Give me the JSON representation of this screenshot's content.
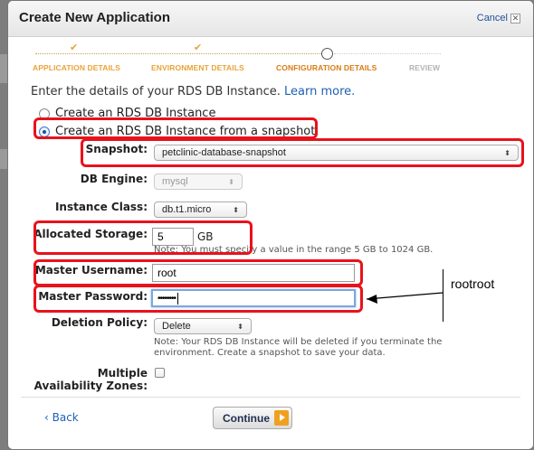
{
  "dialog": {
    "title": "Create New Application",
    "cancel_label": "Cancel",
    "cancel_icon": "close-icon"
  },
  "steps": [
    {
      "label": "APPLICATION DETAILS",
      "state": "done"
    },
    {
      "label": "ENVIRONMENT DETAILS",
      "state": "done"
    },
    {
      "label": "CONFIGURATION DETAILS",
      "state": "current"
    },
    {
      "label": "REVIEW",
      "state": "pending"
    }
  ],
  "step_check_glyph": "✔",
  "intro": {
    "text": "Enter the details of your RDS DB Instance.",
    "link": "Learn more."
  },
  "source": {
    "options": [
      {
        "label": "Create an RDS DB Instance",
        "selected": false
      },
      {
        "label": "Create an RDS DB Instance from a snapshot",
        "selected": true
      }
    ]
  },
  "fields": {
    "snapshot": {
      "label": "Snapshot:",
      "value": "petclinic-database-snapshot"
    },
    "engine": {
      "label": "DB Engine:",
      "value": "mysql",
      "disabled": true
    },
    "instance_class": {
      "label": "Instance Class:",
      "value": "db.t1.micro"
    },
    "storage": {
      "label": "Allocated Storage:",
      "value": "5",
      "unit": "GB",
      "note": "Note: You must specify a value in the range 5 GB to 1024 GB."
    },
    "username": {
      "label": "Master Username:",
      "value": "root"
    },
    "password": {
      "label": "Master Password:",
      "value": "••••••••"
    },
    "deletion_policy": {
      "label": "Deletion Policy:",
      "value": "Delete",
      "note_line1": "Note: Your RDS DB Instance will be deleted if you terminate the",
      "note_line2": "environment. Create a snapshot to save your data."
    },
    "multi_az": {
      "label_line1": "Multiple",
      "label_line2": "Availability Zones:",
      "checked": false
    }
  },
  "footer": {
    "back_label": "‹ Back",
    "continue_label": "Continue"
  },
  "annotation": {
    "callout_text": "rootroot",
    "highlight_color": "#e8121b"
  },
  "colors": {
    "accent_orange": "#e8a33d",
    "link_blue": "#1f5fb4"
  }
}
